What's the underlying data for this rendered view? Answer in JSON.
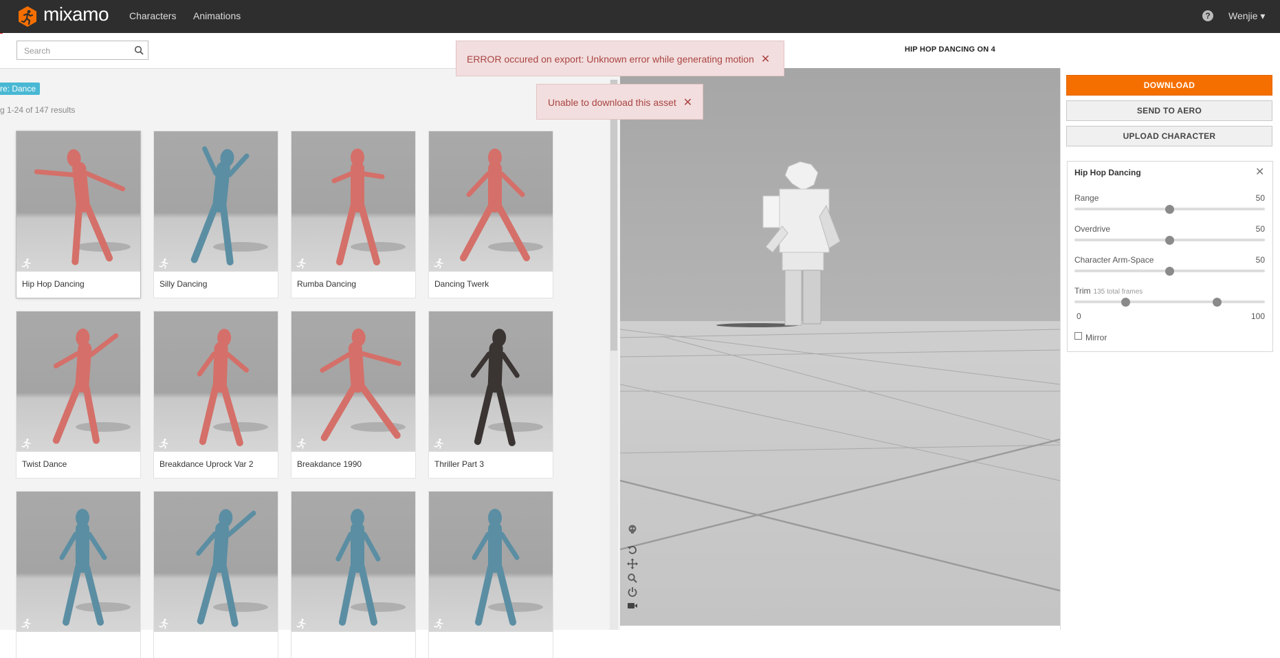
{
  "nav": {
    "brand": "mixamo",
    "links": [
      "Characters",
      "Animations"
    ],
    "help": "?",
    "user": "Wenjie ▾"
  },
  "search": {
    "placeholder": "Search",
    "value": ""
  },
  "filter_badge": "re: Dance",
  "results": "g 1-24 of 147 results",
  "cards": [
    {
      "name": "Hip Hop Dancing",
      "color": "#d47069"
    },
    {
      "name": "Silly Dancing",
      "color": "#5b8ea3"
    },
    {
      "name": "Rumba Dancing",
      "color": "#d47069"
    },
    {
      "name": "Dancing Twerk",
      "color": "#d47069"
    },
    {
      "name": "Twist Dance",
      "color": "#d47069"
    },
    {
      "name": "Breakdance Uprock Var 2",
      "color": "#d47069"
    },
    {
      "name": "Breakdance 1990",
      "color": "#d47069"
    },
    {
      "name": "Thriller Part 3",
      "color": "#3a3432"
    },
    {
      "name": "",
      "color": "#5b8ea3"
    },
    {
      "name": "",
      "color": "#5b8ea3"
    },
    {
      "name": "",
      "color": "#5b8ea3"
    },
    {
      "name": "",
      "color": "#5b8ea3"
    }
  ],
  "viewer": {
    "title": "HIP HOP DANCING ON 4"
  },
  "actions": {
    "download": "DOWNLOAD",
    "send_to_aero": "SEND TO AERO",
    "upload_character": "UPLOAD CHARACTER"
  },
  "settings": {
    "title": "Hip Hop Dancing",
    "close": "✕",
    "range": {
      "label": "Range",
      "value": "50",
      "fraction": 0.5
    },
    "overdrive": {
      "label": "Overdrive",
      "value": "50",
      "fraction": 0.5
    },
    "arm_space": {
      "label": "Character Arm-Space",
      "value": "50",
      "fraction": 0.5
    },
    "trim": {
      "label": "Trim",
      "sub": "135 total frames",
      "min": "0",
      "max": "100",
      "start_fraction": 0.27,
      "end_fraction": 0.75
    },
    "mirror": {
      "label": "Mirror",
      "checked": false
    }
  },
  "toasts": [
    {
      "text": "ERROR occured on export: Unknown error while generating motion",
      "close": "✕"
    },
    {
      "text": "Unable to download this asset",
      "close": "✕"
    }
  ],
  "colors": {
    "accent": "#f56f00",
    "nav_bg": "#2e2e2e",
    "badge": "#49b8d4",
    "error_bg": "#f2dede"
  }
}
